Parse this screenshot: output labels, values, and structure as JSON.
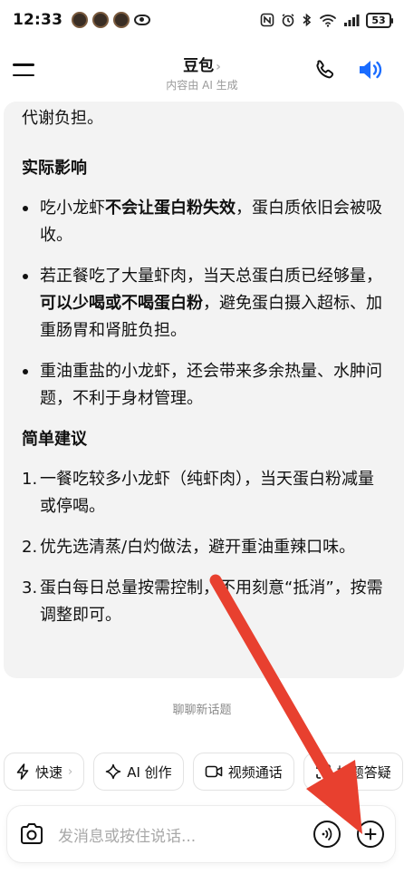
{
  "status_bar": {
    "time": "12:33",
    "icons": [
      "app-notification-icon",
      "app-notification-icon",
      "app-notification-icon",
      "eye-icon",
      "nfc-icon",
      "alarm-icon",
      "bluetooth-icon",
      "wifi-icon",
      "signal-icon"
    ],
    "battery": "53"
  },
  "header": {
    "title": "豆包",
    "subtitle": "内容由 AI 生成",
    "chevron": "›"
  },
  "message": {
    "continued_text": "代谢负担。",
    "section1_title": "实际影响",
    "section1_items": [
      {
        "pre": "吃小龙虾",
        "bold": "不会让蛋白粉失效",
        "post": "，蛋白质依旧会被吸收。"
      },
      {
        "pre": "若正餐吃了大量虾肉，当天总蛋白质已经够量，",
        "bold": "可以少喝或不喝蛋白粉",
        "post": "，避免蛋白摄入超标、加重肠胃和肾脏负担。"
      },
      {
        "pre": "重油重盐的小龙虾，还会带来多余热量、水肿问题，不利于身材管理。",
        "bold": "",
        "post": ""
      }
    ],
    "section2_title": "简单建议",
    "section2_items": [
      {
        "num": "1.",
        "text": "一餐吃较多小龙虾（纯虾肉），当天蛋白粉减量或停喝。"
      },
      {
        "num": "2.",
        "text": "优先选清蒸/白灼做法，避开重油重辣口味。"
      },
      {
        "num": "3.",
        "text": "蛋白每日总量按需控制，不用刻意“抵消”，按需调整即可。"
      }
    ]
  },
  "new_topic": "聊聊新话题",
  "chips": [
    {
      "label": "快速",
      "icon": "lightning-icon",
      "chevron": "›"
    },
    {
      "label": "AI 创作",
      "icon": "sparkle-icon"
    },
    {
      "label": "视频通话",
      "icon": "video-icon"
    },
    {
      "label": "拍题答疑",
      "icon": "scan-icon"
    }
  ],
  "input": {
    "placeholder": "发消息或按住说话..."
  },
  "colors": {
    "accent_blue": "#1a6cff",
    "annotation_red": "#e8402f",
    "card_bg": "#f3f3f3"
  }
}
